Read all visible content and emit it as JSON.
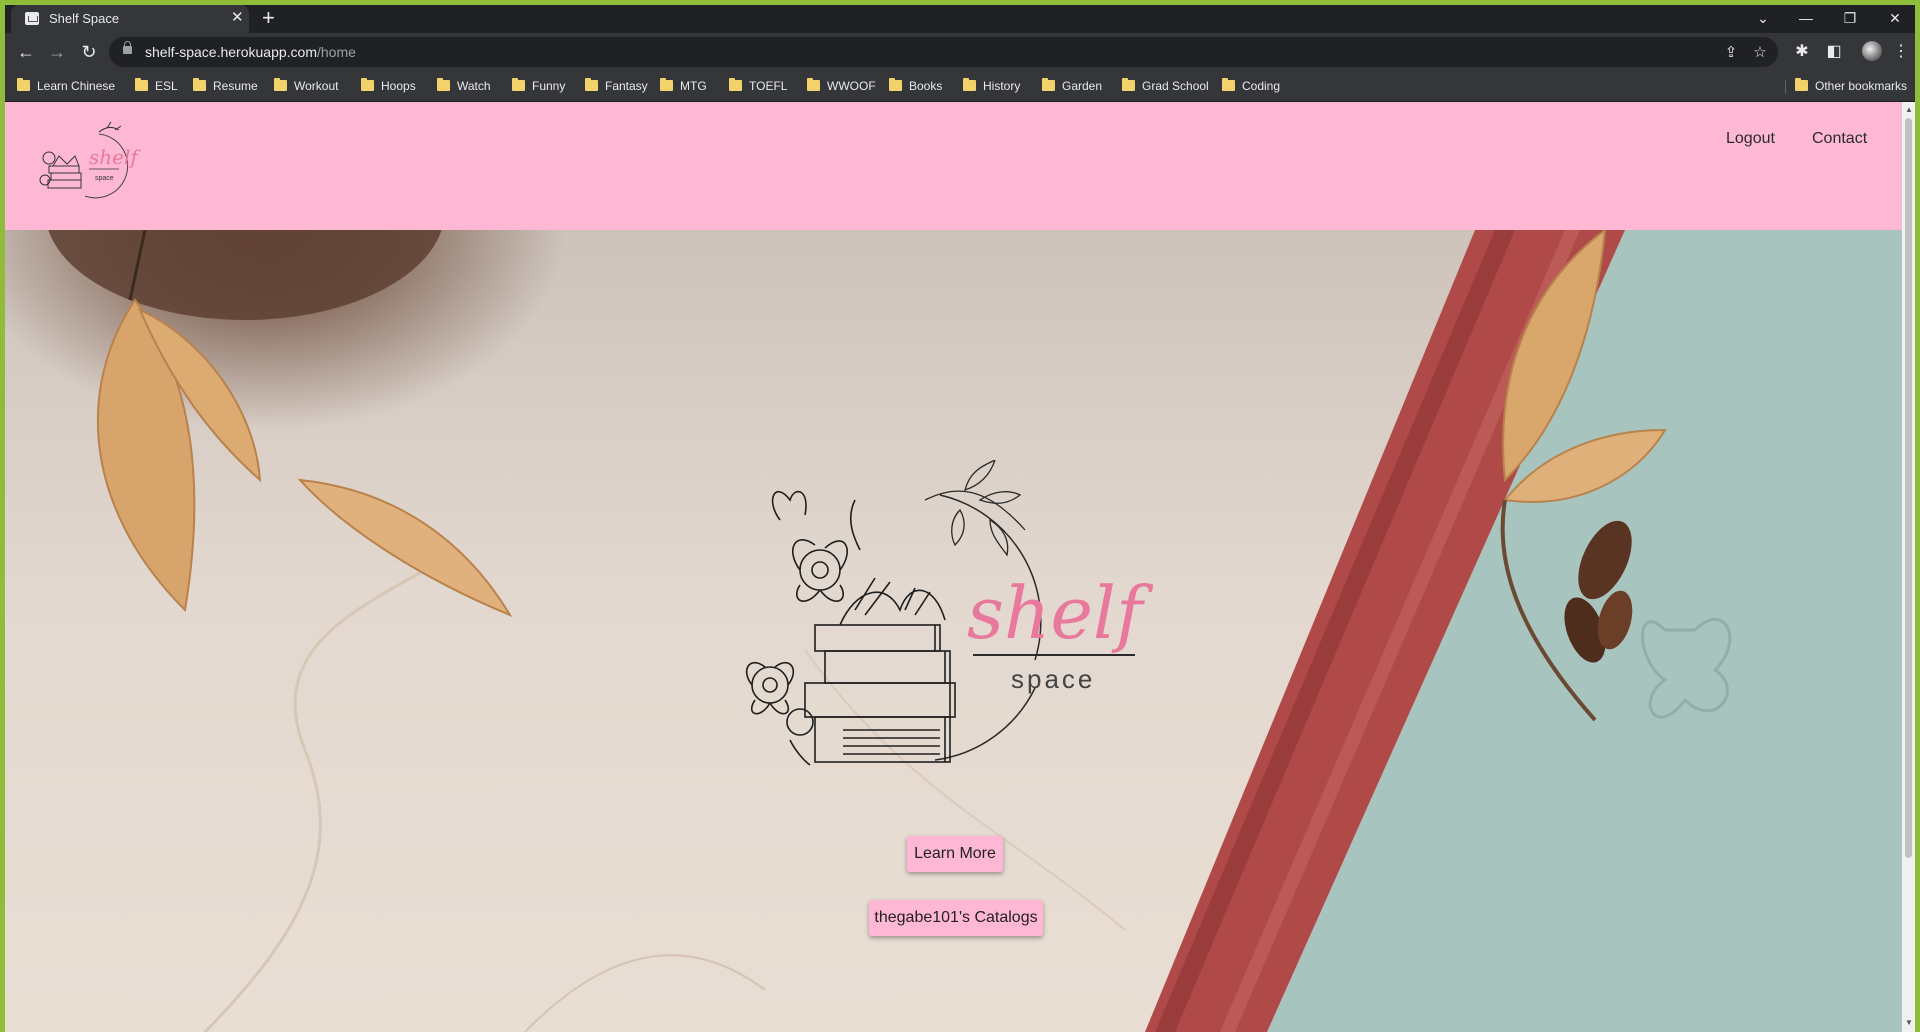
{
  "browser": {
    "tab_title": "Shelf Space",
    "url_host": "shelf-space.herokuapp.com",
    "url_path": "/home",
    "bookmarks": [
      "Learn Chinese",
      "ESL",
      "Resume",
      "Workout",
      "Hoops",
      "Watch",
      "Funny",
      "Fantasy",
      "MTG",
      "TOEFL",
      "WWOOF",
      "Books",
      "History",
      "Garden",
      "Grad School",
      "Coding"
    ],
    "other_bookmarks": "Other bookmarks"
  },
  "header": {
    "logo_word_1": "shelf",
    "logo_word_2": "space",
    "nav": {
      "logout": "Logout",
      "contact": "Contact"
    }
  },
  "hero": {
    "logo_word_1": "shelf",
    "logo_word_2": "space",
    "learn_more": "Learn More",
    "catalogs": "thegabe101's Catalogs"
  },
  "colors": {
    "header_bg": "#ffb8d4",
    "button_bg": "#ffb8d4",
    "logo_script": "#e8789c",
    "book_red": "#b04a48",
    "book_teal": "#a8c4bf"
  }
}
